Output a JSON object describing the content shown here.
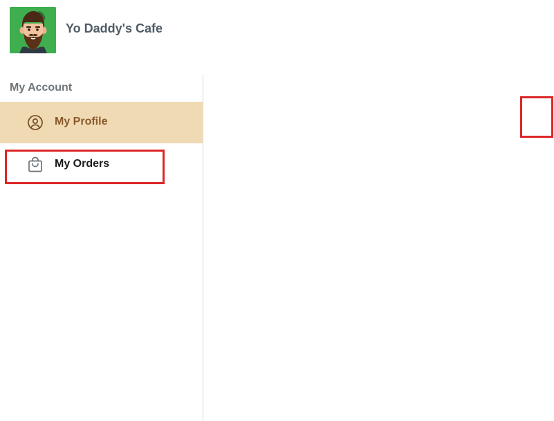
{
  "header": {
    "brand_name": "Yo Daddy's Cafe",
    "logo_icon": "bearded-man-avatar-icon",
    "logo_bg_color": "#3fae4f"
  },
  "sidebar": {
    "section_label": "My Account",
    "items": [
      {
        "label": "My Profile",
        "icon": "user-circle-icon",
        "active": true,
        "active_bg_color": "#f0dab4"
      },
      {
        "label": "My Orders",
        "icon": "shopping-bag-icon",
        "active": false
      }
    ]
  },
  "annotations": {
    "highlight_color": "#dc2626"
  }
}
